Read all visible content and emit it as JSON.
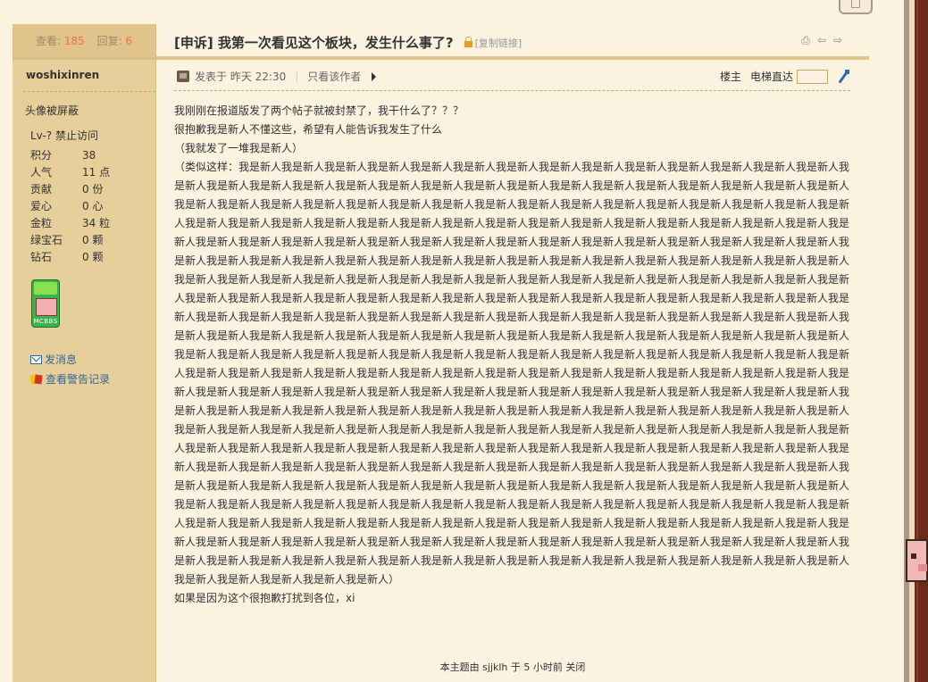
{
  "stats_bar": {
    "views_label": "查看:",
    "views": "185",
    "replies_label": "回复:",
    "replies": "6"
  },
  "thread": {
    "title": "[申诉] 我第一次看见这个板块，发生什么事了?",
    "copy_link": "[复制链接]"
  },
  "author": {
    "username": "woshixinren",
    "avatar_note": "头像被屏蔽",
    "level": "Lv-? 禁止访问",
    "stats": [
      {
        "key": "积分",
        "value": "38"
      },
      {
        "key": "人气",
        "value": "11 点"
      },
      {
        "key": "贡献",
        "value": "0 份"
      },
      {
        "key": "爱心",
        "value": "0 心"
      },
      {
        "key": "金粒",
        "value": "34 粒"
      },
      {
        "key": "绿宝石",
        "value": "0 颗"
      },
      {
        "key": "钻石",
        "value": "0 颗"
      }
    ],
    "medal_label": "MCBBS",
    "send_message": "发消息",
    "view_warnings": "查看警告记录"
  },
  "post_meta": {
    "posted": "发表于 昨天 22:30",
    "separator": "|",
    "only_author": "只看该作者",
    "floor": "楼主",
    "jump_label": "电梯直达"
  },
  "post_body": {
    "line1": "我刚刚在报道版发了两个帖子就被封禁了，我干什么了？？？",
    "line2": "很抱歉我是新人不懂这些，希望有人能告诉我发生了什么",
    "line3": "（我就发了一堆我是新人）",
    "line4": "（类似这样：我是新人我是新人我是新人我是新人我是新人我是新人我是新人我是新人我是新人我是新人我是新人我是新人我是新人我是新人我是新人我是新人我是新人我是新人我是新人我是新人我是新人我是新人我是新人我是新人我是新人我是新人我是新人我是新人我是新人我是新人我是新人我是新人我是新人我是新人我是新人我是新人我是新人我是新人我是新人我是新人我是新人我是新人我是新人我是新人我是新人我是新人我是新人我是新人我是新人我是新人我是新人我是新人我是新人我是新人我是新人我是新人我是新人我是新人我是新人我是新人我是新人我是新人我是新人我是新人我是新人我是新人我是新人我是新人我是新人我是新人我是新人我是新人我是新人我是新人我是新人我是新人我是新人我是新人我是新人我是新人我是新人我是新人我是新人我是新人我是新人我是新人我是新人我是新人我是新人我是新人我是新人我是新人我是新人我是新人我是新人我是新人我是新人我是新人我是新人我是新人我是新人我是新人我是新人我是新人我是新人我是新人我是新人我是新人我是新人我是新人我是新人我是新人我是新人我是新人我是新人我是新人我是新人我是新人我是新人我是新人我是新人我是新人我是新人我是新人我是新人我是新人我是新人我是新人我是新人我是新人我是新人我是新人我是新人我是新人我是新人我是新人我是新人我是新人我是新人我是新人我是新人我是新人我是新人我是新人我是新人我是新人我是新人我是新人我是新人我是新人我是新人我是新人我是新人我是新人我是新人我是新人我是新人我是新人我是新人我是新人我是新人我是新人我是新人我是新人我是新人我是新人我是新人我是新人我是新人我是新人我是新人我是新人我是新人我是新人我是新人我是新人我是新人我是新人我是新人我是新人我是新人我是新人我是新人我是新人我是新人我是新人我是新人我是新人我是新人我是新人我是新人我是新人我是新人我是新人我是新人我是新人我是新人我是新人我是新人我是新人我是新人我是新人我是新人我是新人我是新人我是新人我是新人我是新人我是新人我是新人我是新人我是新人我是新人我是新人我是新人我是新人我是新人我是新人我是新人我是新人我是新人我是新人我是新人我是新人我是新人我是新人我是新人我是新人我是新人我是新人我是新人我是新人我是新人我是新人我是新人我是新人我是新人我是新人我是新人我是新人我是新人我是新人我是新人我是新人我是新人我是新人我是新人我是新人我是新人我是新人我是新人我是新人我是新人我是新人我是新人我是新人我是新人我是新人我是新人我是新人我是新人我是新人我是新人我是新人我是新人我是新人我是新人我是新人我是新人我是新人我是新人我是新人我是新人我是新人我是新人我是新人我是新人我是新人我是新人我是新人我是新人我是新人我是新人我是新人我是新人我是新人我是新人我是新人我是新人我是新人我是新人我是新人我是新人我是新人我是新人我是新人我是新人我是新人我是新人我是新人我是新人我是新人我是新人我是新人我是新人我是新人我是新人我是新人我是新人我是新人我是新人我是新人我是新人我是新人我是新人我是新人我是新人我是新人我是新人我是新人我是新人我是新人我是新人我是新人我是新人我是新人我是新人我是新人我是新人我是新人我是新人我是新人我是新人我是新人我是新人我是新人我是新人我是新人我是新人我是新人我是新人我是新人我是新人我是新人我是新人我是新人我是新人我是新人我是新人我是新人）",
    "line5": "如果是因为这个很抱歉打扰到各位，xi"
  },
  "footer": {
    "closed_notice": "本主题由 sjjklh 于 5 小时前 关闭"
  }
}
